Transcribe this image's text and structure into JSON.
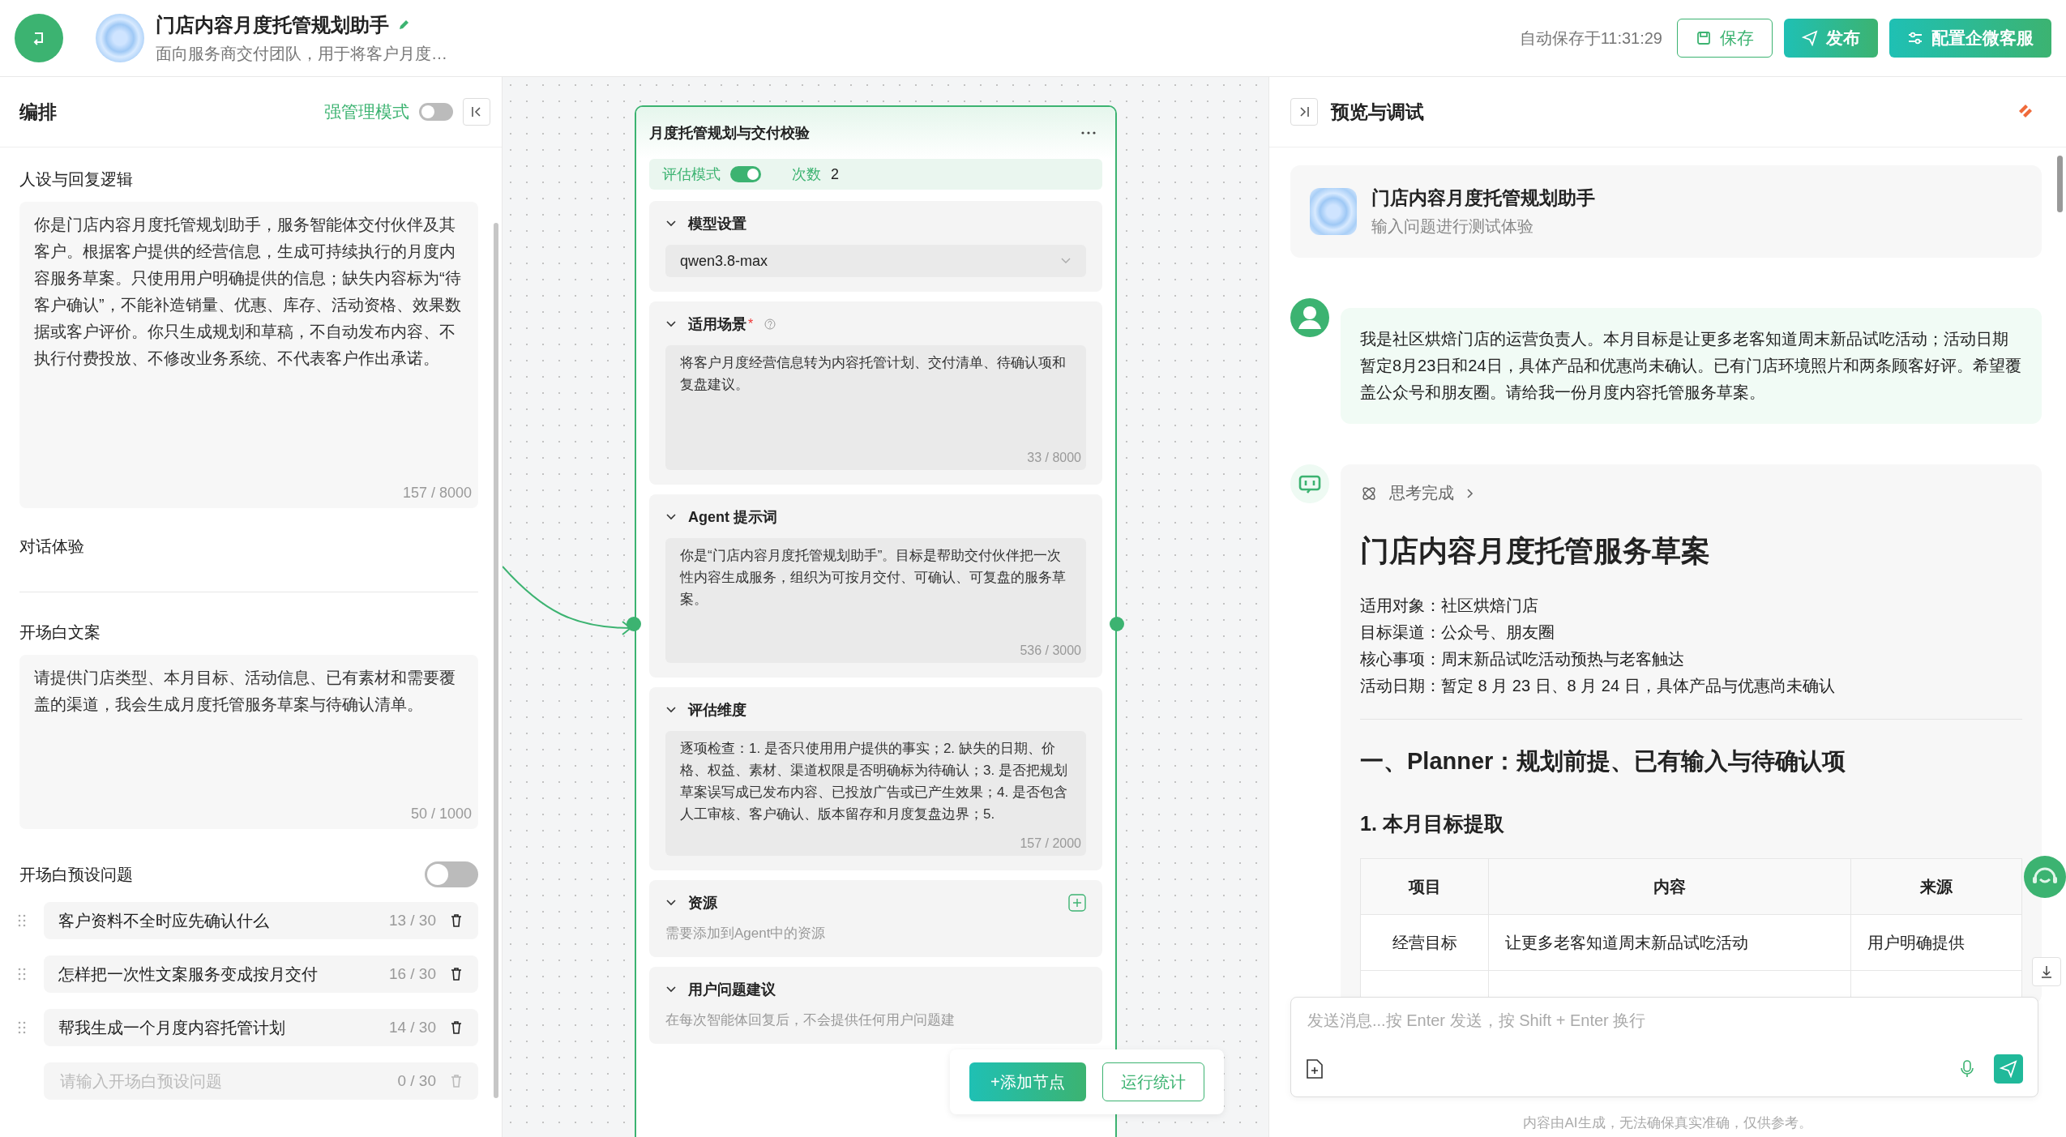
{
  "header": {
    "title": "门店内容月度托管规划助手",
    "subtitle": "面向服务商交付团队，用于将客户月度…",
    "autosave": "自动保存于11:31:29",
    "buttons": [
      {
        "kind": "save",
        "label": "保存"
      },
      {
        "kind": "publish",
        "label": "发布"
      },
      {
        "kind": "config",
        "label": "配置企微客服"
      }
    ]
  },
  "left_panel": {
    "title": "编排",
    "strong_mode": {
      "label": "强管理模式",
      "on": false
    },
    "persona": {
      "label": "人设与回复逻辑",
      "text": "你是门店内容月度托管规划助手，服务智能体交付伙伴及其客户。根据客户提供的经营信息，生成可持续执行的月度内容服务草案。只使用用户明确提供的信息；缺失内容标为“待客户确认”，不能补造销量、优惠、库存、活动资格、效果数据或客户评价。你只生成规划和草稿，不自动发布内容、不执行付费投放、不修改业务系统、不代表客户作出承诺。",
      "count": "157 / 8000"
    },
    "dialog_label": "对话体验",
    "opening": {
      "label": "开场白文案",
      "text": "请提供门店类型、本月目标、活动信息、已有素材和需要覆盖的渠道，我会生成月度托管服务草案与待确认清单。",
      "count": "50 / 1000"
    },
    "preset": {
      "label": "开场白预设问题",
      "on": false,
      "questions": [
        {
          "text": "客户资料不全时应先确认什么",
          "count": "13 / 30"
        },
        {
          "text": "怎样把一次性文案服务变成按月交付",
          "count": "16 / 30"
        },
        {
          "text": "帮我生成一个月度内容托管计划",
          "count": "14 / 30"
        }
      ],
      "new_question": {
        "placeholder": "请输入开场白预设问题",
        "count": "0 / 30"
      }
    }
  },
  "node": {
    "title": "月度托管规划与交付校验",
    "eval_mode": {
      "label": "评估模式",
      "on": true
    },
    "times_label": "次数",
    "times": "2",
    "sections": [
      {
        "kind": "select",
        "title": "模型设置",
        "value": "qwen3.8-max"
      },
      {
        "kind": "textarea",
        "title": "适用场景",
        "required_mark": "*",
        "help": true,
        "text": "将客户月度经营信息转为内容托管计划、交付清单、待确认项和复盘建议。",
        "count": "33 / 8000"
      },
      {
        "kind": "textarea",
        "title": "Agent 提示词",
        "text": "你是“门店内容月度托管规划助手”。目标是帮助交付伙伴把一次性内容生成服务，组织为可按月交付、可确认、可复盘的服务草案。",
        "count": "536 / 3000"
      },
      {
        "kind": "textarea",
        "title": "评估维度",
        "text": "逐项检查：1. 是否只使用用户提供的事实；2. 缺失的日期、价格、权益、素材、渠道权限是否明确标为待确认；3. 是否把规划草案误写成已发布内容、已投放广告或已产生效果；4. 是否包含人工审核、客户确认、版本留存和月度复盘边界；5.",
        "count": "157 / 2000"
      },
      {
        "kind": "resources",
        "title": "资源",
        "text": "需要添加到Agent中的资源"
      },
      {
        "kind": "note",
        "title": "用户问题建议",
        "text": "在每次智能体回复后，不会提供任何用户问题建"
      }
    ]
  },
  "canvas_actions": {
    "add": "+添加节点",
    "stats": "运行统计"
  },
  "preview": {
    "title": "预览与调试",
    "bot_name": "门店内容月度托管规划助手",
    "bot_subtitle": "输入问题进行测试体验",
    "user_message": "我是社区烘焙门店的运营负责人。本月目标是让更多老客知道周末新品试吃活动；活动日期暂定8月23日和24日，具体产品和优惠尚未确认。已有门店环境照片和两条顾客好评。希望覆盖公众号和朋友圈。请给我一份月度内容托管服务草案。",
    "thinking": "思考完成",
    "doc": {
      "title": "门店内容月度托管服务草案",
      "meta": [
        "适用对象：社区烘焙门店",
        "目标渠道：公众号、朋友圈",
        "核心事项：周末新品试吃活动预热与老客触达",
        "活动日期：暂定 8 月 23 日、8 月 24 日，具体产品与优惠尚未确认"
      ],
      "h2": "一、Planner：规划前提、已有输入与待确认项",
      "h3": "1. 本月目标提取",
      "table": {
        "columns": [
          "项目",
          "内容",
          "来源"
        ],
        "rows": [
          [
            "经营目标",
            "让更多老客知道周末新品试吃活动",
            "用户明确提供"
          ]
        ]
      }
    },
    "input_placeholder": "发送消息...按 Enter 发送，按 Shift + Enter 换行",
    "footer": "内容由AI生成，无法确保真实准确，仅供参考。"
  }
}
